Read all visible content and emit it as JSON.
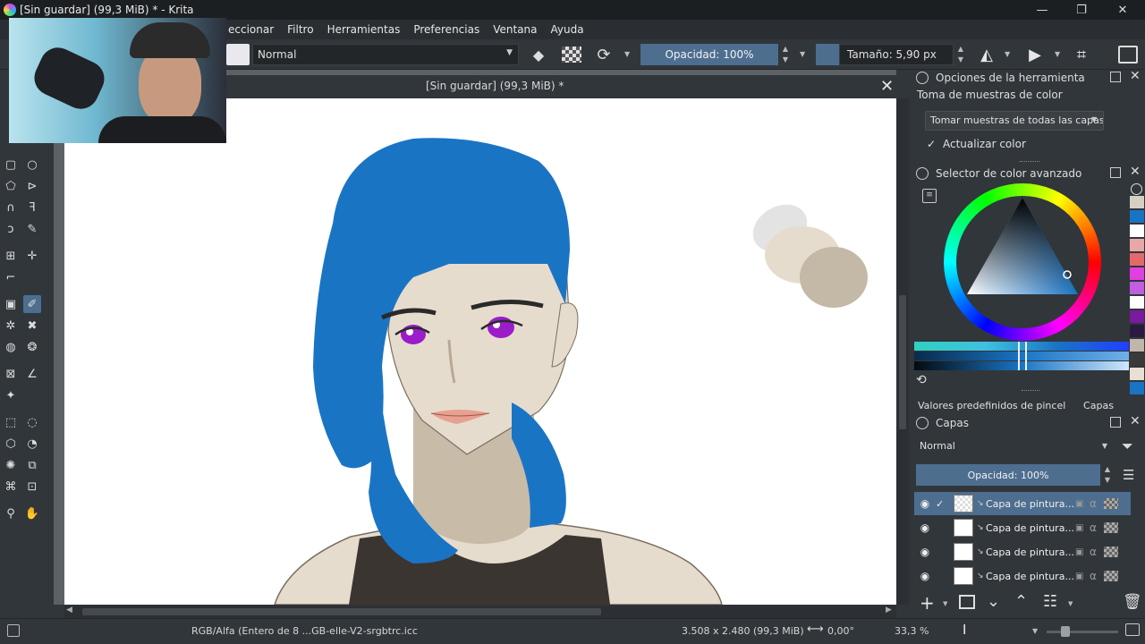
{
  "window": {
    "title": "[Sin guardar]  (99,3 MiB) * - Krita",
    "controls": [
      "—",
      "❐",
      "✕"
    ]
  },
  "menu": [
    "eccionar",
    "Filtro",
    "Herramientas",
    "Preferencias",
    "Ventana",
    "Ayuda"
  ],
  "tool_options_bar": {
    "blend_mode": "Normal",
    "opacity_label": "Opacidad: 100%",
    "size_label": "Tamaño: 5,90 px"
  },
  "document": {
    "tab_title": "[Sin guardar]  (99,3 MiB) *"
  },
  "tool_options_panel": {
    "title": "Opciones de la herramienta",
    "section": "Toma de muestras de color",
    "sample_mode": "Tomar muestras de todas las capas",
    "update_color_label": "Actualizar color",
    "update_color_checked": true
  },
  "color_selector": {
    "title": "Selector de color avanzado",
    "accent": "#1a74c4"
  },
  "tabs": [
    "Valores predefinidos de pincel",
    "Capas"
  ],
  "layers_panel": {
    "title": "Capas",
    "blend_mode": "Normal",
    "opacity_label": "Opacidad:  100%",
    "layers": [
      {
        "name": "Capa de pintura...",
        "selected": true
      },
      {
        "name": "Capa de pintura...",
        "selected": false
      },
      {
        "name": "Capa de pintura...",
        "selected": false
      },
      {
        "name": "Capa de pintura...",
        "selected": false
      }
    ]
  },
  "palette": [
    "#d8cfc4",
    "#1a74c4",
    "#ffffff",
    "#e8a8a8",
    "#e46a6a",
    "#e040e0",
    "#c060e0",
    "#ffffff",
    "#7a1aa0",
    "#2a1a40",
    "#c2b6aa",
    "#3a3a3a",
    "#e8e0d4",
    "#1a74c4"
  ],
  "statusbar": {
    "color_profile": "RGB/Alfa (Entero de 8 ...GB-elle-V2-srgbtrc.icc",
    "dimensions": "3.508 x 2.480 (99,3 MiB)",
    "rotation": "0,00°",
    "zoom": "33,3 %"
  }
}
